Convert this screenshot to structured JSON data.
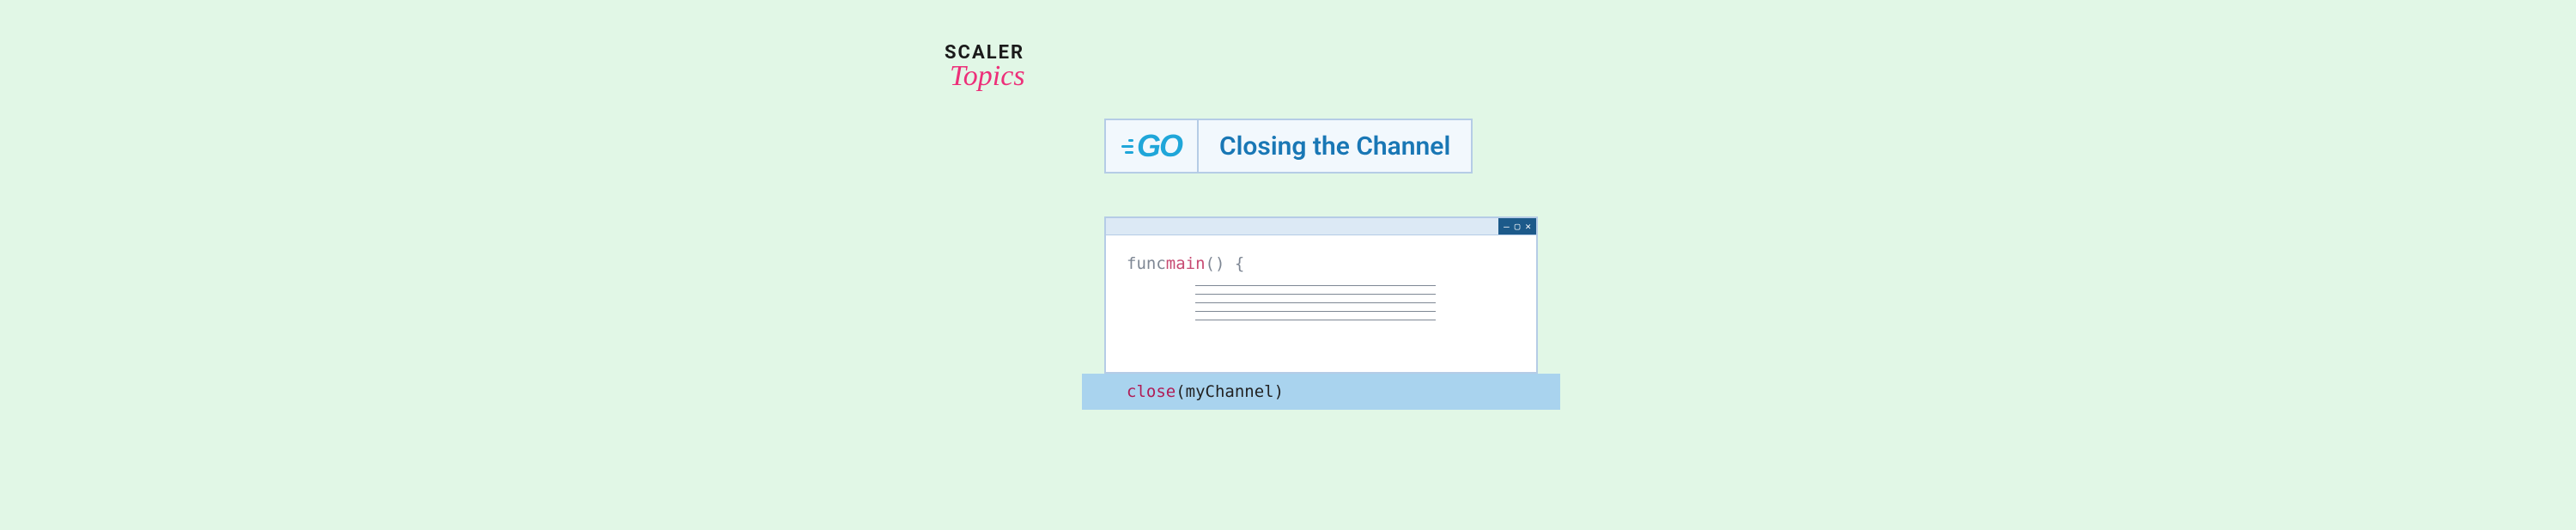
{
  "logo": {
    "line1": "SCALER",
    "line2": "Topics"
  },
  "title": {
    "go_text": "GO",
    "heading": "Closing the Channel"
  },
  "window": {
    "controls": {
      "min": "—",
      "max": "▢",
      "close": "✕"
    }
  },
  "code": {
    "func_kw": "func ",
    "main_fn": "main",
    "parens_brace": "() {",
    "close_fn": "close",
    "arg": "(myChannel)"
  }
}
